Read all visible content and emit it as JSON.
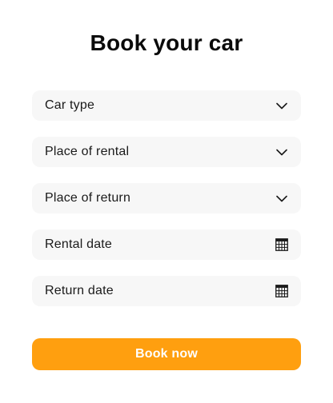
{
  "form": {
    "title": "Book your car",
    "fields": [
      {
        "label": "Car type",
        "icon": "chevron-down-icon"
      },
      {
        "label": "Place of rental",
        "icon": "chevron-down-icon"
      },
      {
        "label": "Place of return",
        "icon": "chevron-down-icon"
      },
      {
        "label": "Rental date",
        "icon": "calendar-icon"
      },
      {
        "label": "Return date",
        "icon": "calendar-icon"
      }
    ],
    "submit_label": "Book now"
  },
  "colors": {
    "accent": "#ff9f0f",
    "field_background": "#f7f7f7",
    "text": "#111111"
  }
}
